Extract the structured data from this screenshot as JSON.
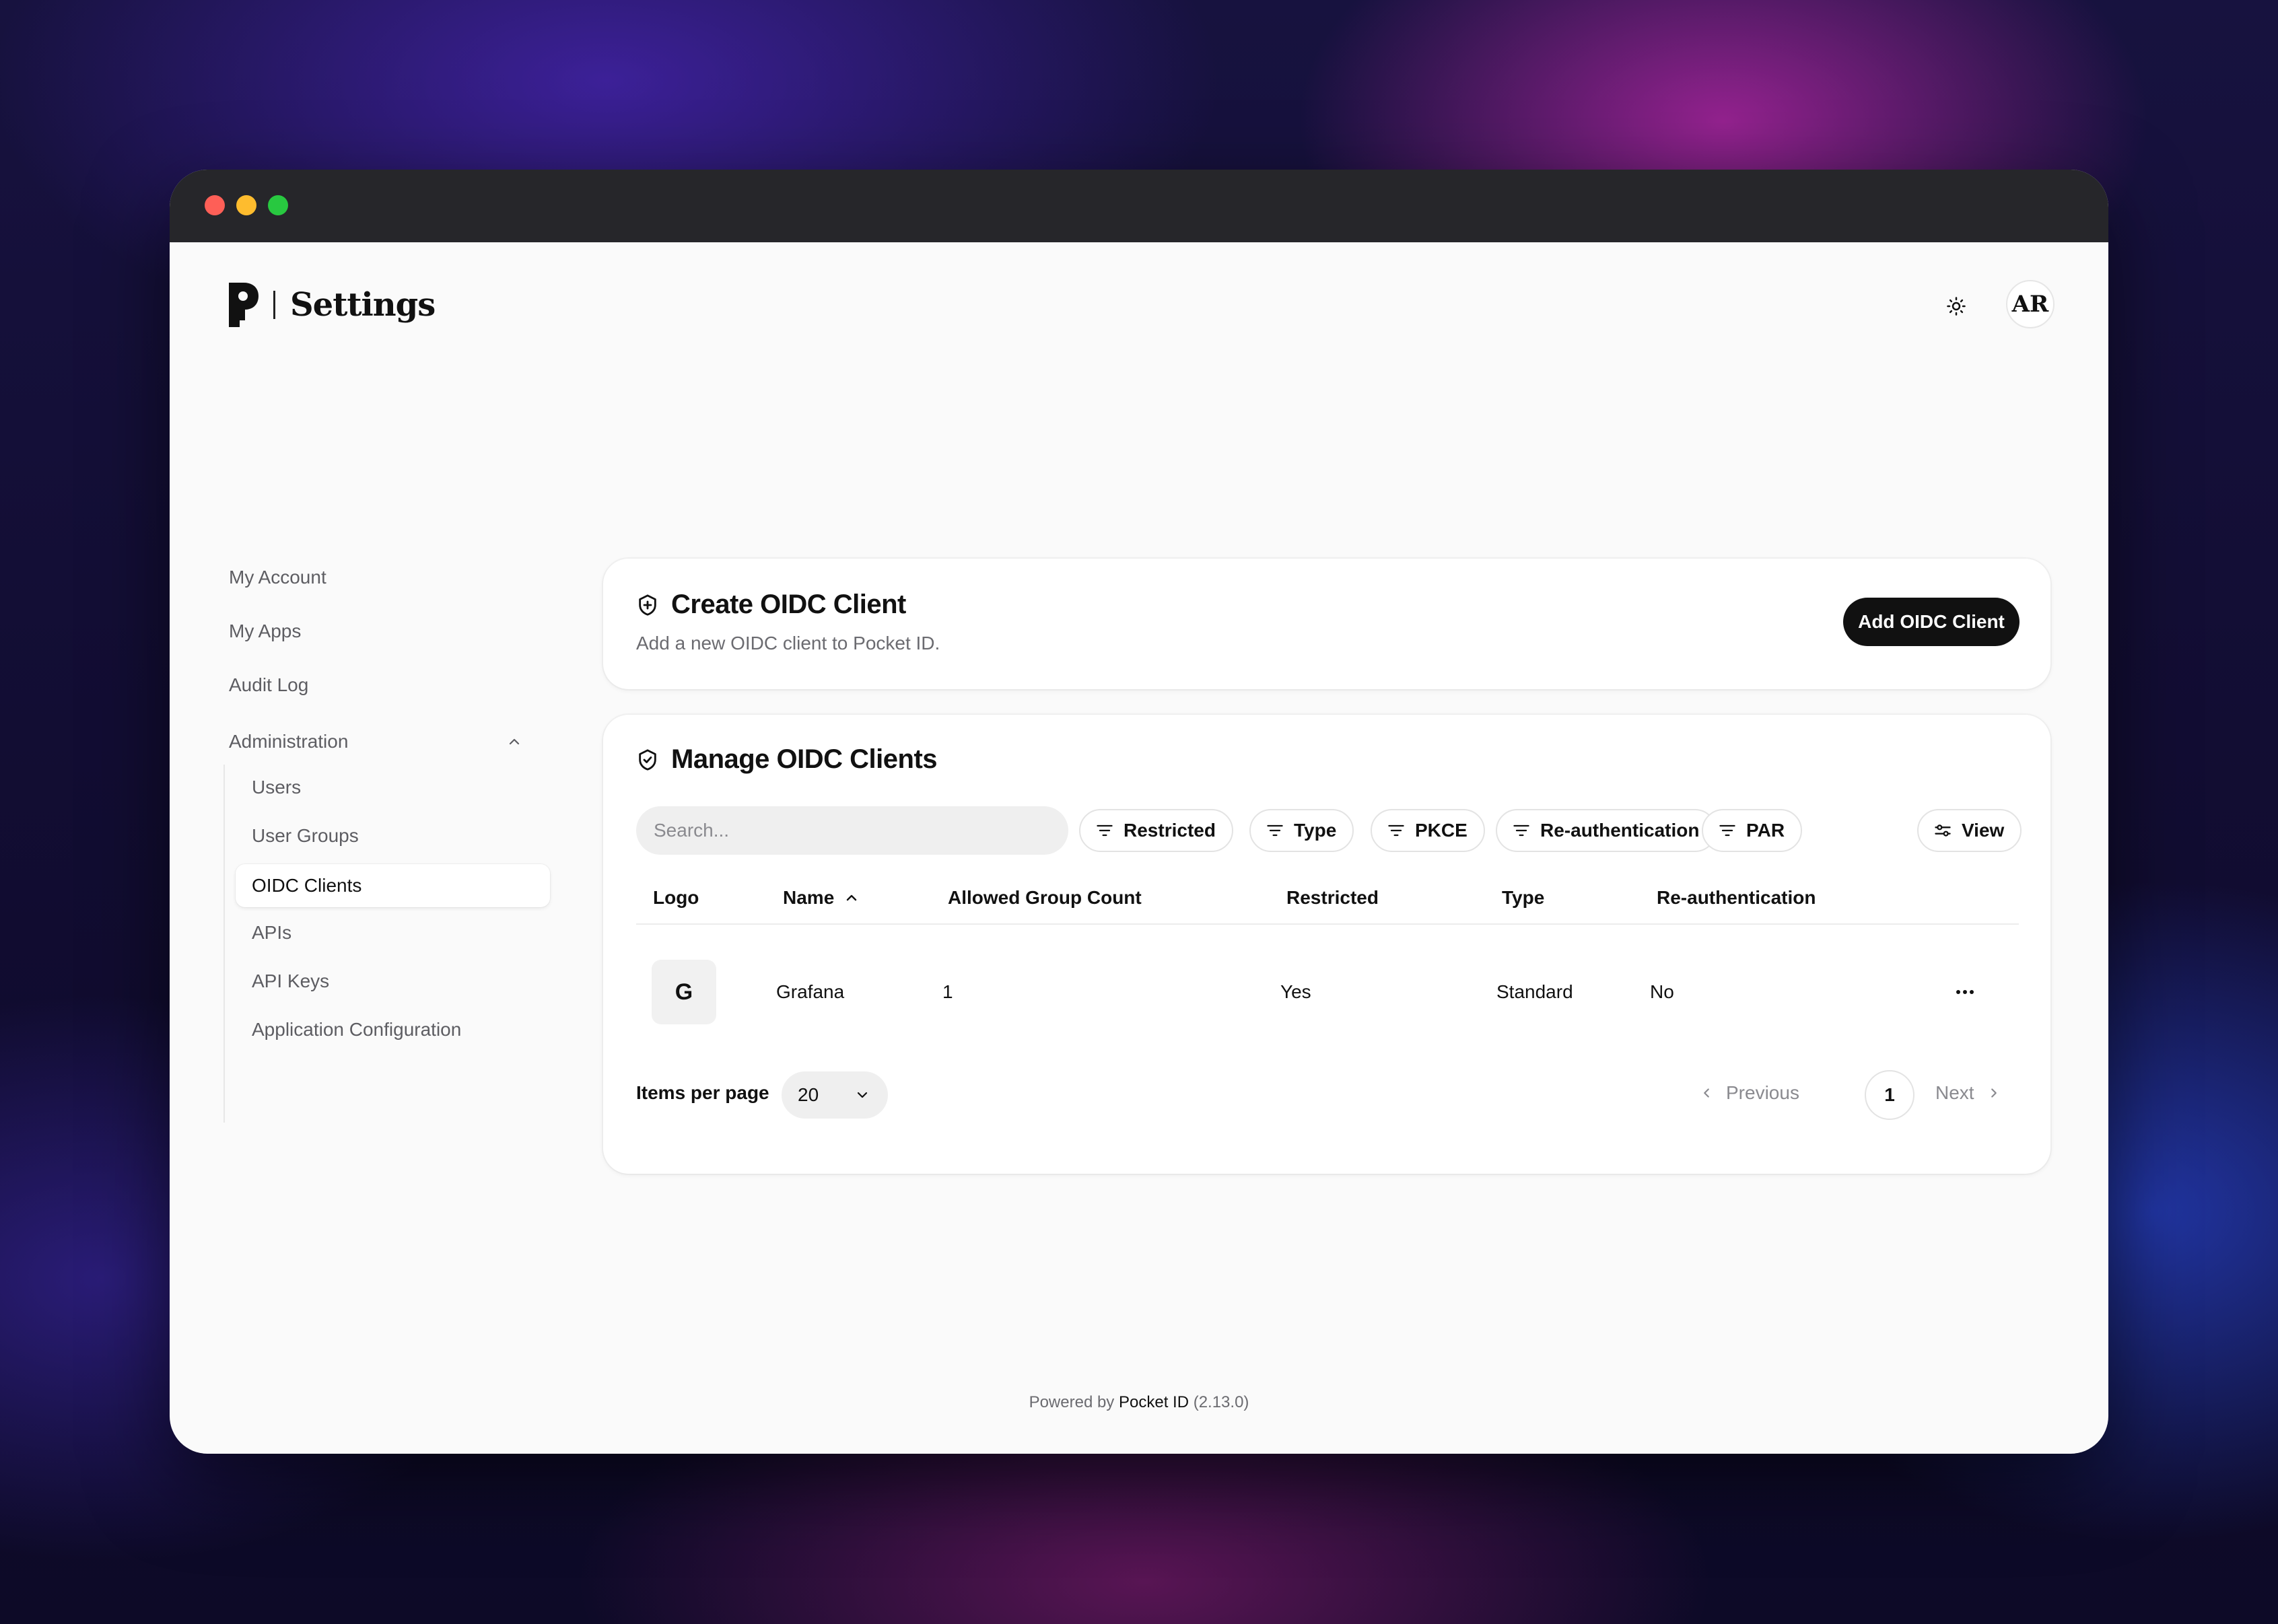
{
  "header": {
    "title": "Settings",
    "avatar_initials": "AR"
  },
  "sidebar": {
    "items": [
      "My Account",
      "My Apps",
      "Audit Log"
    ],
    "admin_label": "Administration",
    "admin_items": [
      "Users",
      "User Groups",
      "OIDC Clients",
      "APIs",
      "API Keys",
      "Application Configuration"
    ],
    "active_item": "OIDC Clients"
  },
  "create_card": {
    "title": "Create OIDC Client",
    "description": "Add a new OIDC client to Pocket ID.",
    "button_label": "Add OIDC Client"
  },
  "manage_card": {
    "title": "Manage OIDC Clients",
    "search_placeholder": "Search...",
    "filters": [
      "Restricted",
      "Type",
      "PKCE",
      "Re-authentication",
      "PAR"
    ],
    "view_label": "View",
    "columns": [
      "Logo",
      "Name",
      "Allowed Group Count",
      "Restricted",
      "Type",
      "Re-authentication"
    ],
    "rows": [
      {
        "logo": "G",
        "name": "Grafana",
        "allowed_group_count": "1",
        "restricted": "Yes",
        "type": "Standard",
        "reauthentication": "No"
      }
    ],
    "pagination": {
      "items_per_page_label": "Items per page",
      "items_per_page": "20",
      "previous": "Previous",
      "current_page": "1",
      "next": "Next"
    }
  },
  "footer": {
    "prefix": "Powered by",
    "link": "Pocket ID",
    "version": "(2.13.0)"
  },
  "colors": {
    "primary_button": "#111111",
    "titlebar": "#26262a",
    "traffic_red": "#fe5f57",
    "traffic_yellow": "#febc2e",
    "traffic_green": "#28c840"
  },
  "icons": {
    "theme": "sun-icon",
    "create_card": "shield-plus-icon",
    "manage_card": "shield-check-icon",
    "filter": "filter-lines-icon",
    "view": "sliders-icon",
    "sort": "chevron-up-icon",
    "row_actions": "more-horizontal-icon"
  }
}
